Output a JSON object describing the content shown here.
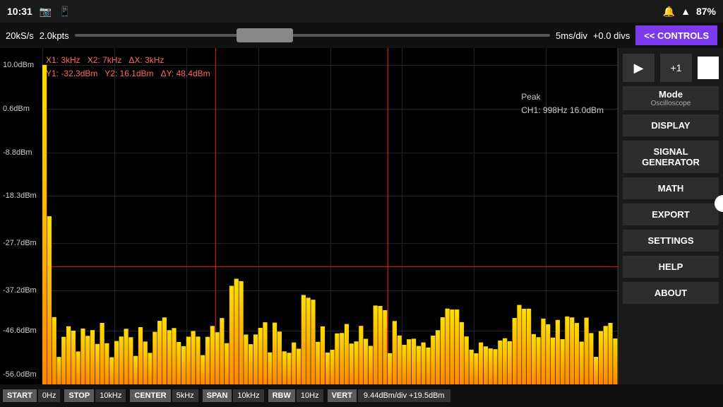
{
  "statusBar": {
    "time": "10:31",
    "battery": "87%"
  },
  "toolbar": {
    "sampleRate": "20kS/s",
    "points": "2.0kpts",
    "timeDiv": "5ms/div",
    "divOffset": "+0.0 divs",
    "controlsBtn": "<< CONTROLS"
  },
  "chart": {
    "yLabels": [
      {
        "value": "10.0dBm",
        "pct": 5
      },
      {
        "value": "0.6dBm",
        "pct": 18
      },
      {
        "value": "-8.8dBm",
        "pct": 31
      },
      {
        "value": "-18.3dBm",
        "pct": 46
      },
      {
        "value": "-27.7dBm",
        "pct": 60
      },
      {
        "value": "-37.2dBm",
        "pct": 74
      },
      {
        "value": "-46.6dBm",
        "pct": 87
      },
      {
        "value": "-56.0dBm",
        "pct": 100
      }
    ],
    "cursor": {
      "x1": "X1: 3kHz",
      "x2": "X2: 7kHz",
      "dx": "ΔX: 3kHz",
      "y1": "Y1: -32.3dBm",
      "y2": "Y2: 16.1dBm",
      "dy": "ΔY: 48.4dBm"
    },
    "peak": {
      "label": "Peak",
      "value": "CH1: 998Hz  16.0dBm"
    }
  },
  "rightPanel": {
    "playLabel": "▶",
    "plus1Label": "+1",
    "modeLabel": "Mode",
    "modeSub": "Oscilloscope",
    "displayLabel": "DISPLAY",
    "signalGenLabel": "SIGNAL\nGENERATOR",
    "mathLabel": "MATH",
    "exportLabel": "EXPORT",
    "settingsLabel": "SETTINGS",
    "helpLabel": "HELP",
    "aboutLabel": "ABOUT"
  },
  "bottomBar": {
    "startLabel": "START",
    "startVal": "0Hz",
    "stopLabel": "STOP",
    "stopVal": "10kHz",
    "centerLabel": "CENTER",
    "centerVal": "5kHz",
    "spanLabel": "SPAN",
    "spanVal": "10kHz",
    "rbwLabel": "RBW",
    "rbwVal": "10Hz",
    "vertLabel": "VERT",
    "vertVal": "9.44dBm/div  +19.5dBm"
  }
}
